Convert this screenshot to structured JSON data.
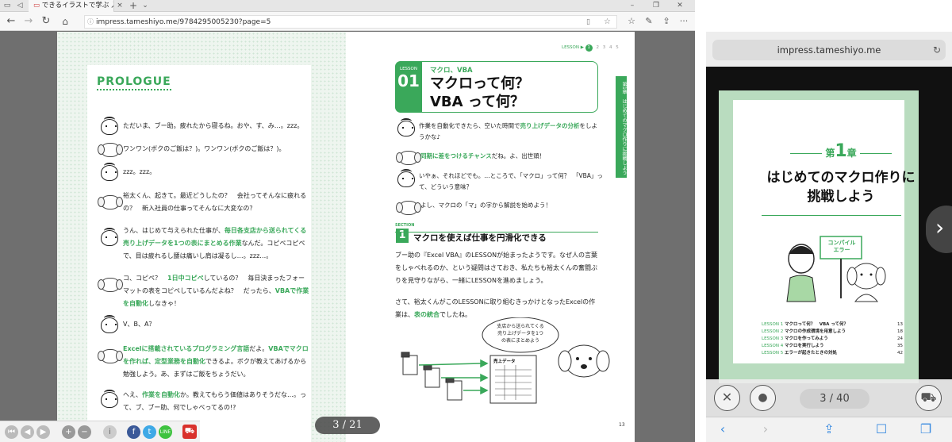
{
  "browser": {
    "tab_title": "できるイラストで学ぶ 入社",
    "url": "impress.tameshiyo.me/9784295005230?page=5",
    "new_tab": "+"
  },
  "left_page": {
    "heading": "PROLOGUE",
    "dialogues": [
      {
        "speaker": "person",
        "text": "ただいま、ブー助。疲れたから寝るね。おや、す、み…。zzz。"
      },
      {
        "speaker": "dog",
        "text": "ワンワン(ボクのご飯は？)。ワンワン(ボクのご飯は？)。"
      },
      {
        "speaker": "person",
        "text": "zzz。zzz。"
      },
      {
        "speaker": "dog",
        "text": "裕太くん、起きて。最近どうしたの？　会社ってそんなに疲れるの？　新入社員の仕事ってそんなに大変なの？"
      },
      {
        "speaker": "person",
        "pre": "うん、はじめて与えられた仕事が、",
        "em": "毎日各支店から送られてくる売り上げデータを1つの表にまとめる作業",
        "post": "なんだ。コピペコピペで、目は疲れるし腰は痛いし肩は凝るし…。zzz…。"
      },
      {
        "speaker": "dog",
        "pre": "コ、コピペ？　",
        "em": "1日中コピペ",
        "mid": "しているの？　毎日決まったフォーマットの表をコピペしているんだよね？　だったら、",
        "em2": "VBAで作業を自動化",
        "post": "しなきゃ！"
      },
      {
        "speaker": "person",
        "text": "V、B、A？"
      },
      {
        "speaker": "dog",
        "em": "Excelに搭載されているプログラミング言語",
        "mid": "だよ。",
        "em2": "VBAでマクロを作れば、定型業務を自動化",
        "post": "できるよ。ボクが教えてあげるから勉強しよう。あ、まずはご飯をちょうだい。"
      },
      {
        "speaker": "person",
        "pre": "へえ、",
        "em": "作業を自動化",
        "post": "か。教えてもらう価値はありそうだな…。って、ブ、ブー助、何でしゃべってるの!?"
      }
    ]
  },
  "right_page": {
    "lesson_nav": "LESSON ▶",
    "lesson_nav_pages": [
      "1",
      "2",
      "3",
      "4",
      "5"
    ],
    "lesson_label": "LESSON",
    "lesson_number": "01",
    "lesson_category": "マクロ、VBA",
    "lesson_title_1": "マクロって何？",
    "lesson_title_2": "VBA って何？",
    "side_tab": "第1章　はじめてのマクロ作りに挑戦しよう",
    "dialogues": [
      {
        "speaker": "person",
        "pre": "作業を自動化できたら、空いた時間で",
        "em": "売り上げデータの分析",
        "post": "をしようかな♪"
      },
      {
        "speaker": "dog",
        "pre": "",
        "em": "同期に差をつけるチャンス",
        "post": "だね。よ、出世頭！"
      },
      {
        "speaker": "person",
        "pre": "いやぁ、それほどでも。…ところで、「マクロ」って何？　「VBA」って、どういう意味？",
        "em": "",
        "post": ""
      },
      {
        "speaker": "dog",
        "pre": "よし、マクロの「マ」の字から解説を始めよう！",
        "em": "",
        "post": ""
      }
    ],
    "section_label": "SECTION",
    "section_number": "1",
    "section_title": "マクロを使えば仕事を円滑化できる",
    "paragraph_1": "ブー助の『Excel VBA』のLESSONが始まったようです。なぜ人の言葉をしゃべれるのか、という疑問はさておき、私たちも裕太くんの奮闘ぶりを見守りながら、一緒にLESSONを進めましょう。",
    "paragraph_2_pre": "さて、裕太くんがこのLESSONに取り組むきっかけとなったExcelの作業は、",
    "paragraph_2_em": "表の統合",
    "paragraph_2_post": "でしたね。",
    "bubble_1": "支店から送られてくる",
    "bubble_2": "売り上げデータを1つ",
    "bubble_3": "の表にまとめよう",
    "sheet_label": "売上データ",
    "page_number": "13"
  },
  "viewer": {
    "page_indicator": "3 / 21"
  },
  "phone": {
    "url": "impress.tameshiyo.me",
    "chapter_pre": "第",
    "chapter_num": "1",
    "chapter_post": "章",
    "chapter_title_1": "はじめてのマクロ作りに",
    "chapter_title_2": "挑戦しよう",
    "sign_1": "コンパイル",
    "sign_2": "エラー",
    "toc": [
      {
        "label": "LESSON 1",
        "title": "マクロって何？　VBA って何？",
        "page": "13"
      },
      {
        "label": "LESSON 2",
        "title": "マクロの作成環境を用意しよう",
        "page": "18"
      },
      {
        "label": "LESSON 3",
        "title": "マクロを作ってみよう",
        "page": "24"
      },
      {
        "label": "LESSON 4",
        "title": "マクロを実行しよう",
        "page": "35"
      },
      {
        "label": "LESSON 5",
        "title": "エラーが起きたときの対処",
        "page": "42"
      }
    ],
    "page_indicator": "3 / 40"
  },
  "colors": {
    "accent": "#3aa85a",
    "side_bg": "#b9dcbf"
  }
}
